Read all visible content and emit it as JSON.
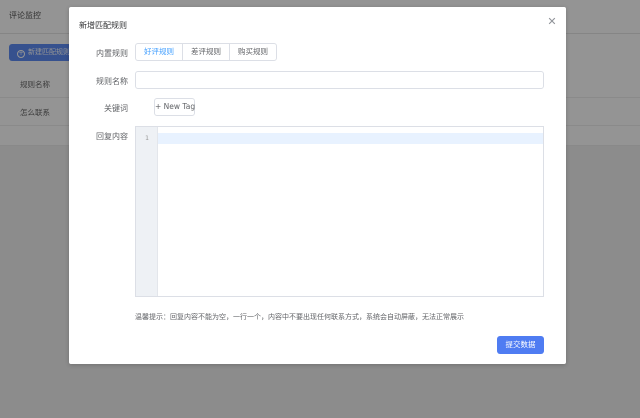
{
  "background": {
    "header_title": "评论监控",
    "add_button_label": "新建匹配规则",
    "rows": [
      "规则名称",
      "怎么联系"
    ]
  },
  "dialog": {
    "title": "新增匹配规则",
    "close_icon": "close-icon",
    "builtin_rules_label": "内置规则",
    "builtin_rules": [
      "好评规则",
      "差评规则",
      "购买规则"
    ],
    "selected_rule": "好评规则",
    "rule_name_label": "规则名称",
    "rule_name_value": "",
    "keywords_label": "关键词",
    "new_tag_label": "+ New Tag",
    "reply_label": "回复内容",
    "editor_line_number": "1",
    "hint": "温馨提示：回复内容不能为空，一行一个，内容中不要出现任何联系方式，系统会自动屏蔽，无法正常展示",
    "submit_label": "提交数据"
  },
  "colors": {
    "primary": "#4f7cf2",
    "active_tab_text": "#409eff",
    "editor_active_line": "#e8f2ff"
  }
}
